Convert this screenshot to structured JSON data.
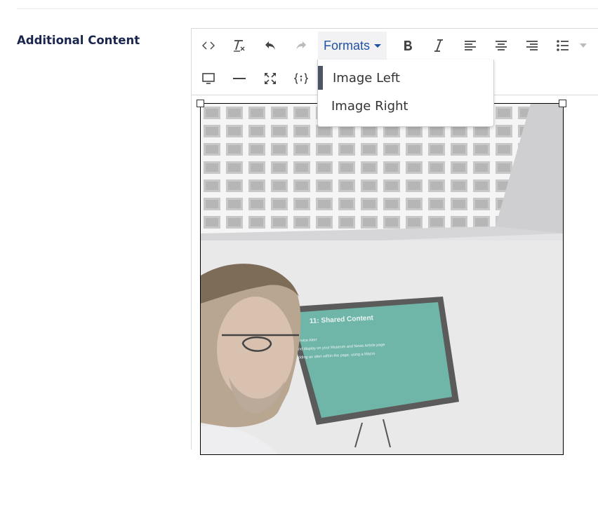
{
  "field": {
    "label": "Additional Content"
  },
  "toolbar": {
    "formats_label": "Formats",
    "buttons": [
      {
        "name": "source-code-button",
        "icon": "code-icon"
      },
      {
        "name": "remove-format-button",
        "icon": "clear-format-icon"
      },
      {
        "name": "undo-button",
        "icon": "undo-icon"
      },
      {
        "name": "redo-button",
        "icon": "redo-icon"
      },
      {
        "name": "bold-button",
        "icon": "bold-icon"
      },
      {
        "name": "italic-button",
        "icon": "italic-icon"
      },
      {
        "name": "align-left-button",
        "icon": "align-left-icon"
      },
      {
        "name": "align-center-button",
        "icon": "align-center-icon"
      },
      {
        "name": "align-right-button",
        "icon": "align-right-icon"
      },
      {
        "name": "bullet-list-button",
        "icon": "bullet-list-icon"
      },
      {
        "name": "bullet-list-dropdown-button",
        "icon": "caret-down-icon"
      },
      {
        "name": "preview-button",
        "icon": "monitor-icon"
      },
      {
        "name": "horizontal-rule-button",
        "icon": "horizontal-rule-icon"
      },
      {
        "name": "fullscreen-button",
        "icon": "fullscreen-icon"
      },
      {
        "name": "insert-macro-button",
        "icon": "macro-icon"
      }
    ]
  },
  "formats_menu": {
    "items": [
      {
        "label": "Image Left",
        "active": true
      },
      {
        "label": "Image Right",
        "active": false
      }
    ]
  },
  "photo": {
    "slide_title": "11: Shared Content",
    "slide_lines": [
      "a Service Alert",
      "g, and display on your Museum and News Article page",
      "ry adding an alert within the page, using a Macro"
    ]
  },
  "colors": {
    "text": "#1b264f",
    "formats_text": "#2152a3",
    "formats_bg": "#f2f2f5",
    "border": "#d8d7d9",
    "active_marker": "#4b5563"
  }
}
